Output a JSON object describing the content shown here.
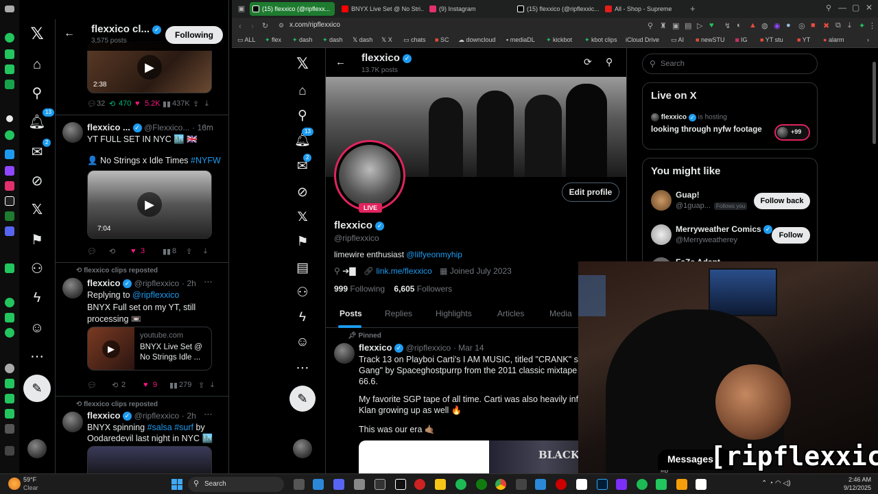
{
  "left_panel": {
    "header": {
      "name": "flexxico cl...",
      "posts": "3,575 posts",
      "following_button": "Following"
    },
    "nav_badges": {
      "notifications": "13",
      "messages": "2"
    },
    "tweet1": {
      "duration": "2:38",
      "replies": "32",
      "retweets": "470",
      "likes": "5.2K",
      "views": "437K"
    },
    "tweet2": {
      "name": "flexxico ...",
      "handle": "@Flexxico...",
      "time": "16m",
      "text1": "YT FULL SET IN NYC 🏙️ 🇬🇧",
      "text2_prefix": "👤 No Strings x Idle Times ",
      "text2_tag": "#NYFW",
      "duration": "7:04",
      "retweets": "",
      "likes": "3",
      "views": "8"
    },
    "tweet3": {
      "repost": "flexxico clips reposted",
      "name": "flexxico",
      "handle": "@ripflexxico",
      "time": "2h",
      "replying_label": "Replying to ",
      "replying_handle": "@ripflexxico",
      "text": "BNYX Full set on my YT, still processing 📼",
      "card_domain": "youtube.com",
      "card_title": "BNYX Live Set @ No Strings Idle ...",
      "retweets": "2",
      "likes": "9",
      "views": "279"
    },
    "tweet4": {
      "repost": "flexxico clips reposted",
      "name": "flexxico",
      "handle": "@ripflexxico",
      "time": "2h",
      "text_prefix": "BNYX spinning ",
      "tag1": "#salsa",
      "tag2": "#surf",
      "text_suffix": " by",
      "text2": "Oodaredevil last night in NYC 🏙️"
    }
  },
  "browser": {
    "tabs": [
      {
        "label": "(15) flexxico (@ripflexx...",
        "color": "#1e7b2f"
      },
      {
        "label": "BNYX Live Set @ No Stri...",
        "color": "#ff0000"
      },
      {
        "label": "(9) Instagram",
        "color": "#e1306c"
      },
      {
        "label": "(15) flexxico (@ripflexxic...",
        "color": "#000000"
      },
      {
        "label": "All - Shop - Supreme",
        "color": "#e31d1a"
      }
    ],
    "url": "x.com/ripflexxico",
    "bookmarks": [
      "ALL",
      "flex",
      "dash",
      "dash",
      "dash",
      "X",
      "chats",
      "SC",
      "downcloud",
      "mediaDL",
      "kickbot",
      "kbot clips",
      "iCloud Drive",
      "AI",
      "newSTU",
      "IG",
      "YT stu",
      "YT",
      "alarm"
    ]
  },
  "profile": {
    "header_name": "flexxico",
    "header_posts": "13.7K posts",
    "live_badge": "LIVE",
    "edit_button": "Edit profile",
    "display_name": "flexxico",
    "handle": "@ripflexxico",
    "bio_prefix": "limewire enthusiast ",
    "bio_mention": "@lilfyeonmyhip",
    "link": "link.me/flexxico",
    "joined": "Joined July 2023",
    "following_count": "999",
    "following_label": "Following",
    "followers_count": "6,605",
    "followers_label": "Followers",
    "tabs": [
      "Posts",
      "Replies",
      "Highlights",
      "Articles",
      "Media"
    ],
    "nav_badges": {
      "notifications": "13",
      "messages": "2"
    }
  },
  "pinned": {
    "label": "Pinned",
    "name": "flexxico",
    "handle": "@ripflexxico",
    "date": "· Mar 14",
    "p1": "Track 13 on Playboi Carti's I AM MUSIC, titled \"CRANK\" samples \"F",
    "p1b": "Gang\" by Spaceghostpurrp from the 2011 classic mixtape Blacklan",
    "p1c": "66.6.",
    "p2": "My favorite SGP tape of all time. Carti was also heavily influenced b",
    "p2b": "Klan growing up as well 🔥",
    "p3": "This was our era 🤙🏽",
    "image_text": "BLACKLAND RADI"
  },
  "sidebar": {
    "search_placeholder": "Search",
    "live": {
      "title": "Live on X",
      "host_name": "flexxico",
      "host_status": "is hosting",
      "space_title": "looking through nyfw footage",
      "listeners": "+99"
    },
    "might_like": {
      "title": "You might like",
      "users": [
        {
          "name": "Guap!",
          "handle": "@1guap...",
          "follows_you": "Follows you",
          "button": "Follow back"
        },
        {
          "name": "Merryweather Comics",
          "handle": "@Merryweatherey",
          "follows_you": "",
          "button": "Follow"
        },
        {
          "name": "FaZe Adapt",
          "handle": "",
          "follows_you": "",
          "button": ""
        }
      ]
    }
  },
  "overlay": {
    "messages_label": "Messages",
    "stream_tag": "[ripflexxico]",
    "partial_text": "Mu",
    "partial_text2": "#b"
  },
  "taskbar": {
    "weather_temp": "59°F",
    "weather_desc": "Clear",
    "search_label": "Search",
    "time": "2:46 AM",
    "date": "9/12/2025"
  }
}
